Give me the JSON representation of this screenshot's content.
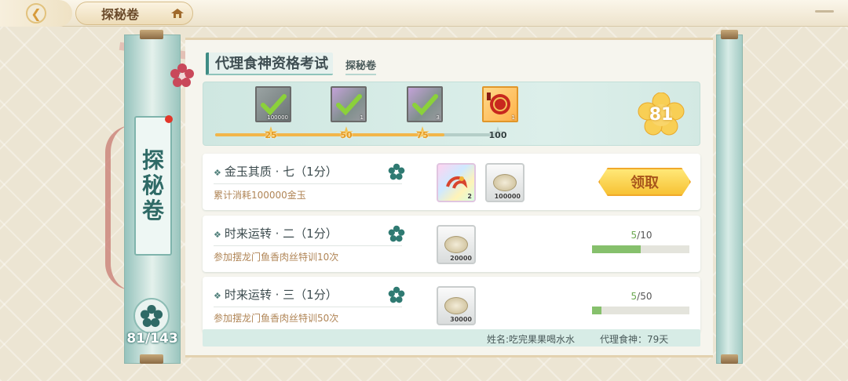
{
  "header": {
    "back_icon": "back-arrow-icon",
    "tab_title": "探秘卷",
    "home_icon": "home-roof-icon"
  },
  "sidebar": {
    "vertical_title_chars": [
      "探",
      "秘",
      "卷"
    ],
    "progress": "81/143"
  },
  "exam": {
    "title": "代理食神资格考试",
    "subtitle": "探秘卷"
  },
  "milestones": {
    "current_points": "81",
    "progress_fraction": 0.81,
    "items": [
      {
        "threshold": "25",
        "reward_qty": "100000",
        "claimed": true
      },
      {
        "threshold": "50",
        "reward_qty": "1",
        "claimed": true
      },
      {
        "threshold": "75",
        "reward_qty": "3",
        "claimed": true
      },
      {
        "threshold": "100",
        "reward_qty": "1",
        "claimed": false
      }
    ]
  },
  "tasks": [
    {
      "name": "金玉其质 · 七（1分）",
      "desc": "累计消耗100000金玉",
      "rewards": [
        {
          "qty": "2",
          "style": "rainbow"
        },
        {
          "qty": "100000",
          "style": "shell"
        }
      ],
      "status": "claim",
      "claim_label": "领取"
    },
    {
      "name": "时来运转 · 二（1分）",
      "desc": "参加摆龙门鱼香肉丝特训10次",
      "rewards": [
        {
          "qty": "20000",
          "style": "shell"
        }
      ],
      "status": "progress",
      "progress_current": "5",
      "progress_total": "/10",
      "progress_fraction": 0.5
    },
    {
      "name": "时来运转 · 三（1分）",
      "desc": "参加摆龙门鱼香肉丝特训50次",
      "rewards": [
        {
          "qty": "30000",
          "style": "shell"
        }
      ],
      "status": "progress",
      "progress_current": "5",
      "progress_total": "/50",
      "progress_fraction": 0.1
    }
  ],
  "footer": {
    "player_name": "姓名:吃完果果喝水水",
    "days": "代理食神：79天"
  },
  "colors": {
    "accent_teal": "#3f8c84",
    "gold": "#f2b64a",
    "progress_green": "#86c06c"
  }
}
